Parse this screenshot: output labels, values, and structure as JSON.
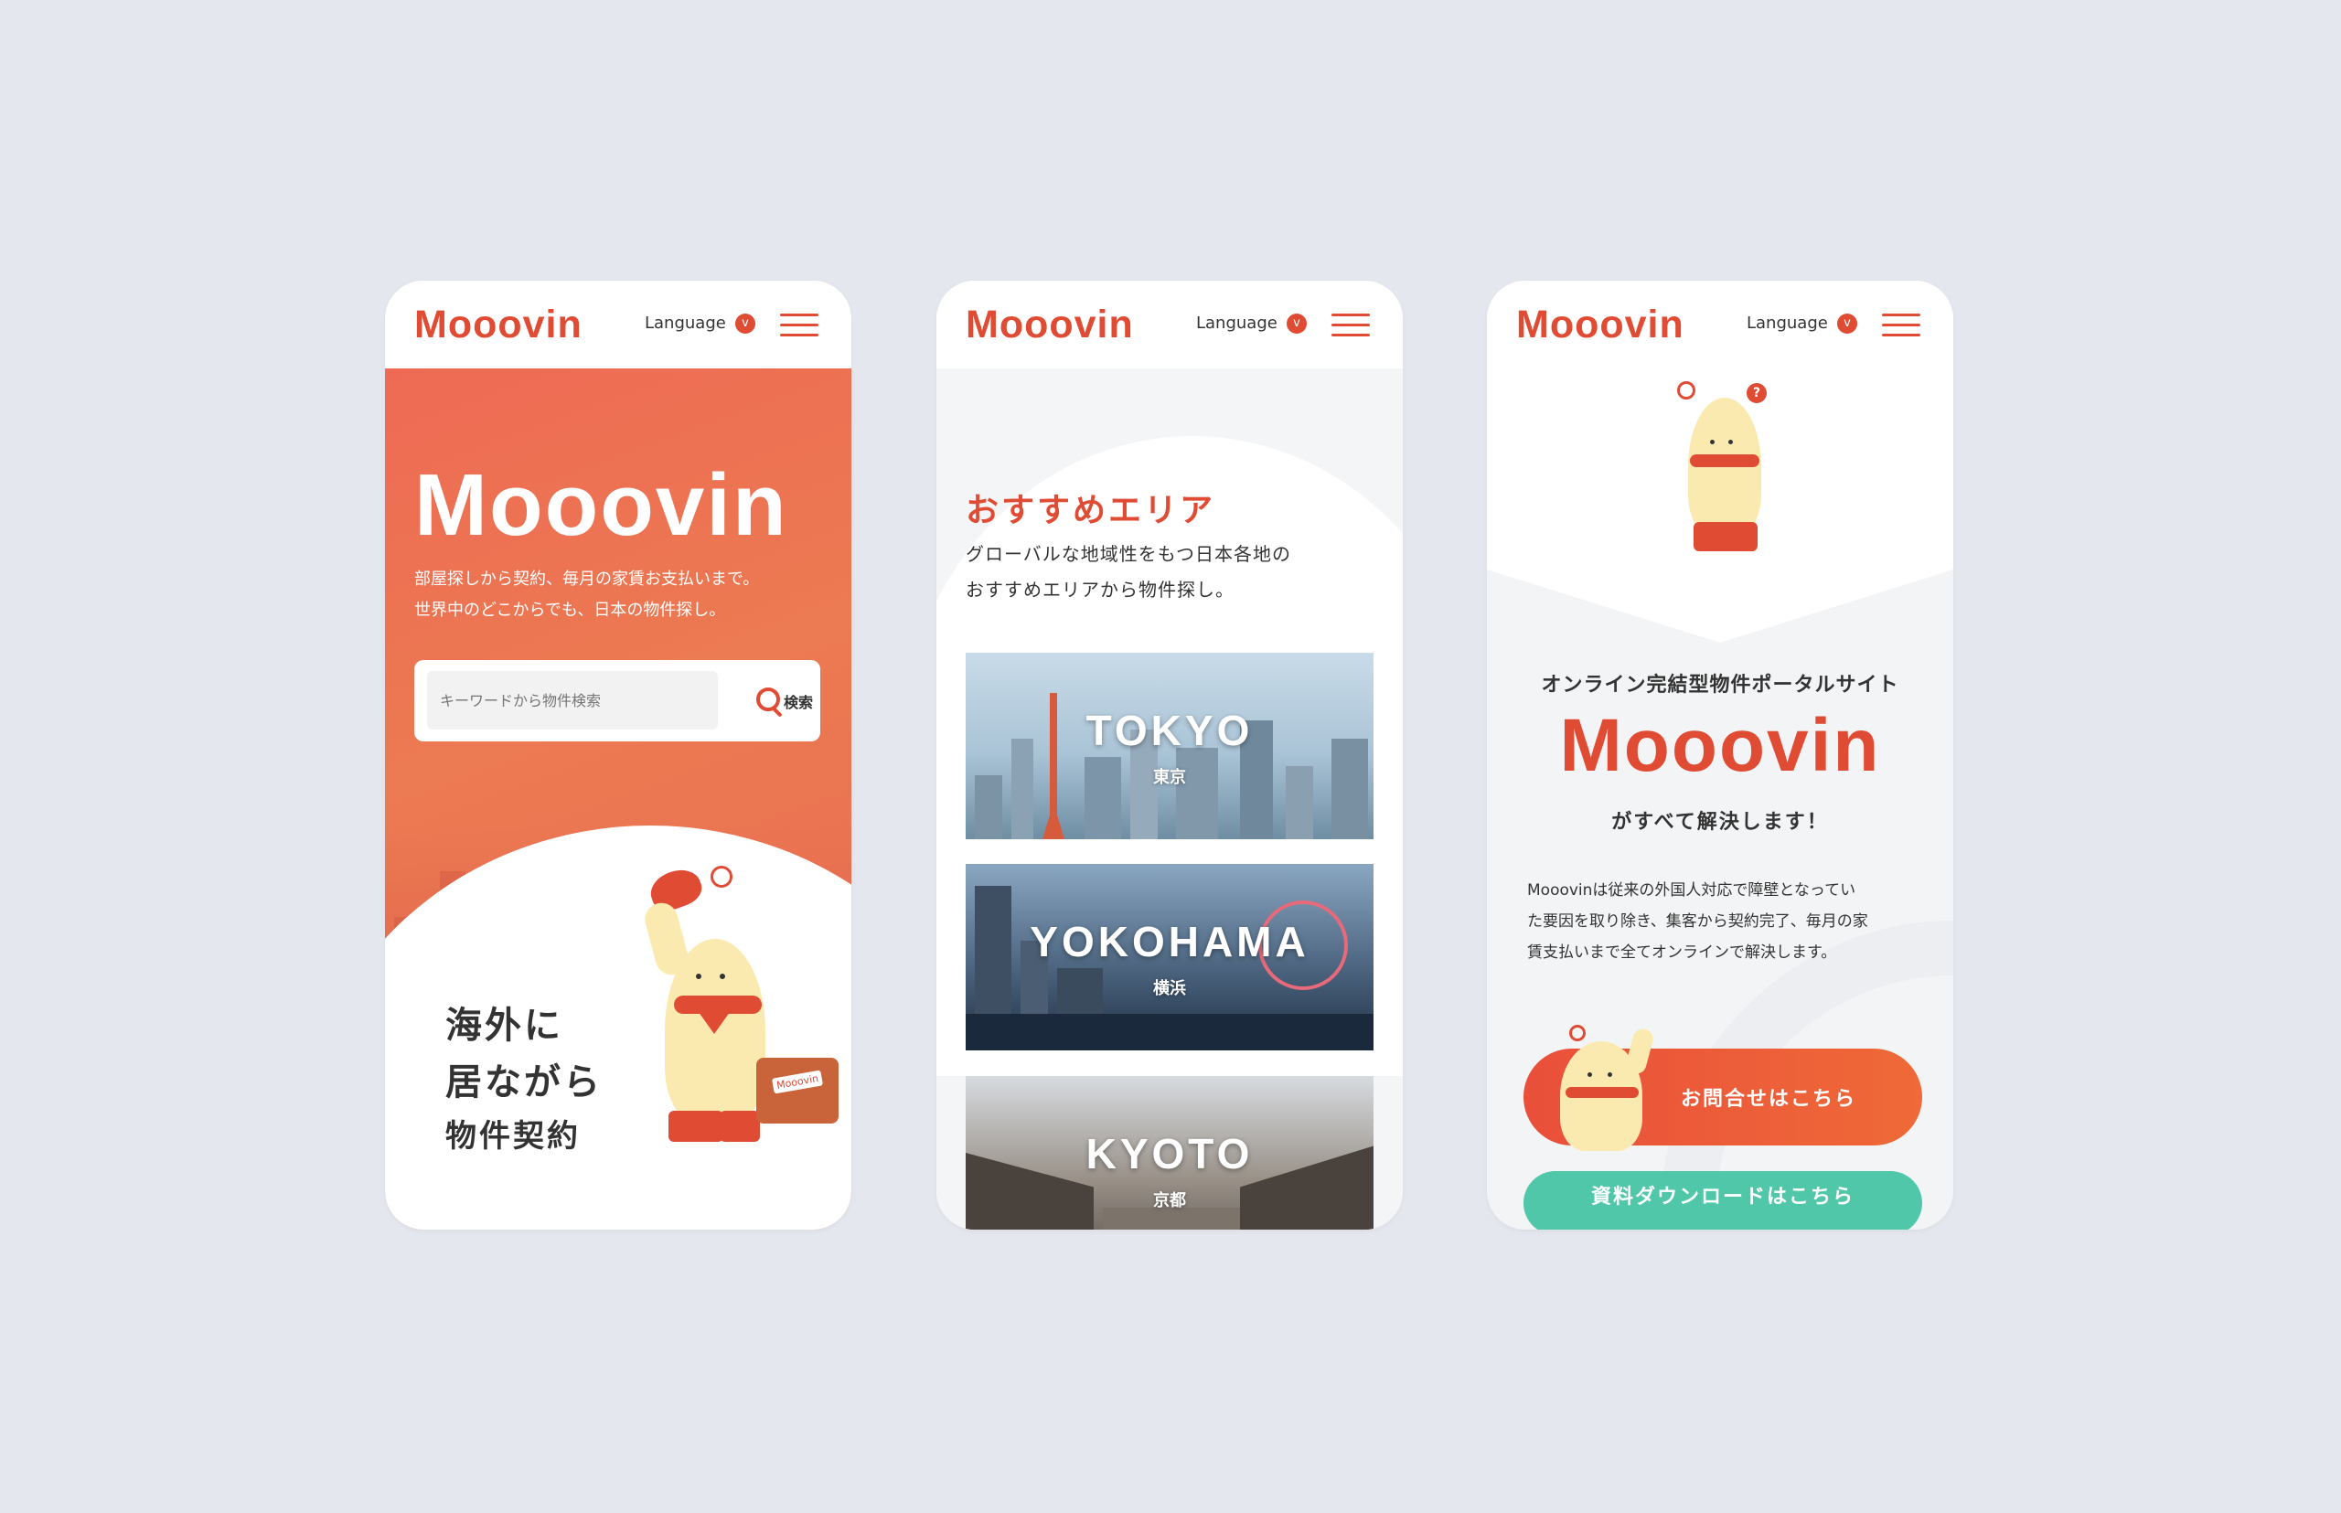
{
  "brand": "Mooovin",
  "header": {
    "language_label": "Language",
    "language_caret": "v"
  },
  "screen1": {
    "hero_title": "Mooovin",
    "hero_sub_line1": "部屋探しから契約、毎月の家賃お支払いまで。",
    "hero_sub_line2": "世界中のどこからでも、日本の物件探し。",
    "search_placeholder": "キーワードから物件検索",
    "search_button": "検索",
    "catch_line1": "海外に",
    "catch_line2": "居ながら",
    "catch_line3": "物件契約",
    "suitcase_tag": "Mooovin"
  },
  "screen2": {
    "section_title": "おすすめエリア",
    "section_desc_line1": "グローバルな地域性をもつ日本各地の",
    "section_desc_line2": "おすすめエリアから物件探し。",
    "areas": [
      {
        "en": "TOKYO",
        "jp": "東京"
      },
      {
        "en": "YOKOHAMA",
        "jp": "横浜"
      },
      {
        "en": "KYOTO",
        "jp": "京都"
      }
    ]
  },
  "screen3": {
    "question_mark": "?",
    "subtitle": "オンライン完結型物件ポータルサイト",
    "logo": "Mooovin",
    "solve": "がすべて解決します！",
    "desc_line1": "Mooovinは従来の外国人対応で障壁となってい",
    "desc_line2": "た要因を取り除き、集客から契約完了、毎月の家",
    "desc_line3": "賃支払いまで全てオンラインで解決します。",
    "contact_button": "お問合せはこちら",
    "download_button": "資料ダウンロードはこちら"
  },
  "colors": {
    "brand_red": "#e04b34",
    "accent_green": "#4fc7a8",
    "page_bg": "#e4e7ee"
  }
}
